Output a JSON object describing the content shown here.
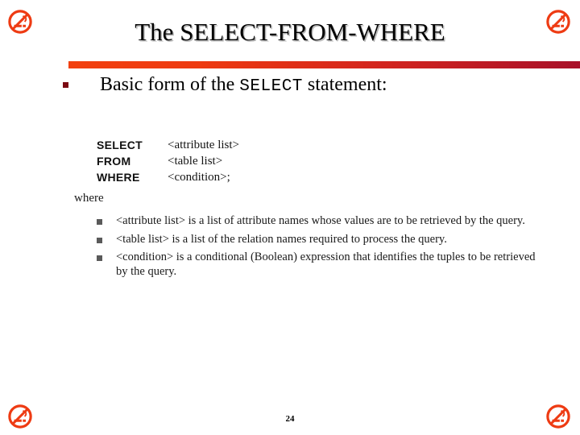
{
  "slide": {
    "title": "The SELECT-FROM-WHERE",
    "page_number": "24",
    "accent_color_start": "#F2400F",
    "accent_color_end": "#A81029",
    "bullet_color": "#7B0A12",
    "icon_color": "#EE3B13"
  },
  "icons": {
    "top_left": "no-smoking-icon",
    "top_right": "no-smoking-icon",
    "bottom_left": "no-smoking-icon",
    "bottom_right": "no-smoking-icon"
  },
  "body": {
    "lead_bullet": {
      "prefix": "Basic form of the ",
      "keyword": "SELECT",
      "suffix": " statement:"
    },
    "syntax": [
      {
        "keyword": "SELECT",
        "argument": "<attribute list>"
      },
      {
        "keyword": "FROM",
        "argument": "<table list>"
      },
      {
        "keyword": "WHERE",
        "argument": "<condition>;"
      }
    ],
    "where_label": "where",
    "definitions": [
      "<attribute list> is a list of attribute names whose values are to be retrieved by the query.",
      "<table list> is a list of the relation names required to process the query.",
      "<condition> is a conditional (Boolean) expression that identifies the tuples to be retrieved by the query."
    ]
  }
}
